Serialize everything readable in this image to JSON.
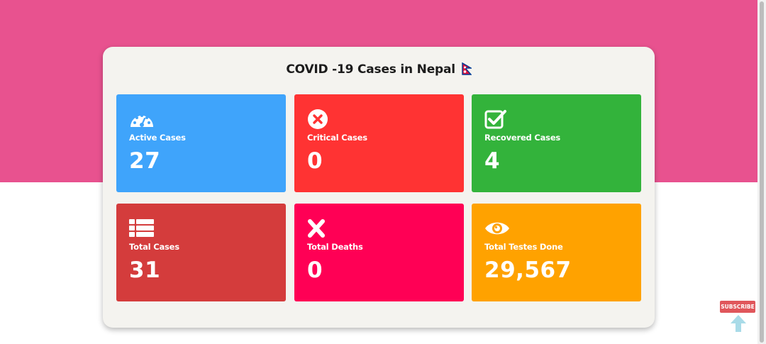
{
  "page": {
    "title": "COVID -19 Cases in Nepal",
    "colors": {
      "hero_band": "#e8528f",
      "card_bg": "#f4f3ef",
      "active": "#3fa4fb",
      "critical": "#ff3333",
      "recovered": "#33b33b",
      "total_cases": "#d43c3c",
      "total_deaths": "#ff0055",
      "tests": "#ffa200"
    }
  },
  "stats": [
    {
      "label": "Active Cases",
      "value": "27",
      "icon": "tachometer-icon"
    },
    {
      "label": "Critical Cases",
      "value": "0",
      "icon": "times-circle-icon"
    },
    {
      "label": "Recovered Cases",
      "value": "4",
      "icon": "check-square-icon"
    },
    {
      "label": "Total Cases",
      "value": "31",
      "icon": "list-icon"
    },
    {
      "label": "Total Deaths",
      "value": "0",
      "icon": "times-icon"
    },
    {
      "label": "Total Testes Done",
      "value": "29,567",
      "icon": "eye-icon"
    }
  ],
  "widget": {
    "subscribe_label": "SUBSCRIBE",
    "scroll_icon": "arrow-up-icon"
  }
}
